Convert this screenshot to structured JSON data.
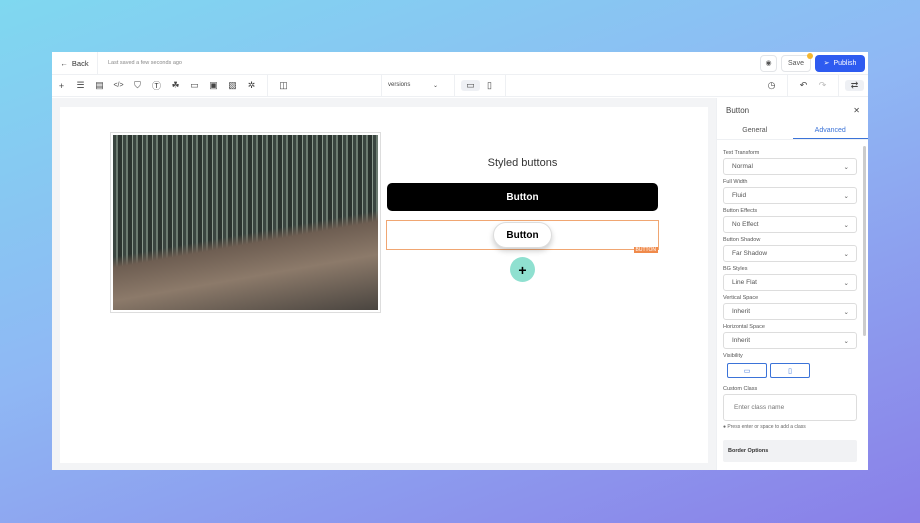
{
  "header": {
    "back": "Back",
    "last_saved": "Last saved a few seconds ago",
    "save": "Save",
    "publish": "Publish"
  },
  "toolbar": {
    "versions": "versions",
    "icons": [
      "plus-icon",
      "layers-icon",
      "page-icon",
      "code-icon",
      "paint-icon",
      "text-icon",
      "shapes-icon",
      "window-icon",
      "form-icon",
      "terminal-icon",
      "settings-icon",
      "columns-icon"
    ]
  },
  "canvas": {
    "heading": "Styled buttons",
    "button1": "Button",
    "button2": "Button",
    "selected_tag": "BUTTON",
    "add": "+"
  },
  "panel": {
    "title": "Button",
    "tabs": [
      "General",
      "Advanced"
    ],
    "active_tab": "Advanced",
    "fields": [
      {
        "label": "Text Transform",
        "value": "Normal"
      },
      {
        "label": "Full Width",
        "value": "Fluid"
      },
      {
        "label": "Button Effects",
        "value": "No Effect"
      },
      {
        "label": "Button Shadow",
        "value": "Far Shadow"
      },
      {
        "label": "BG Styles",
        "value": "Line Flat"
      },
      {
        "label": "Vertical Space",
        "value": "Inherit"
      },
      {
        "label": "Horizontal Space",
        "value": "Inherit"
      }
    ],
    "visibility_label": "Visibility",
    "custom_class_label": "Custom Class",
    "custom_class_placeholder": "Enter class name",
    "hint": "Press enter or space to add a class",
    "border_options": "Border Options"
  },
  "colors": {
    "accent": "#2e5bf0",
    "selection": "#f0a672",
    "add_button": "#8fe0d0"
  }
}
